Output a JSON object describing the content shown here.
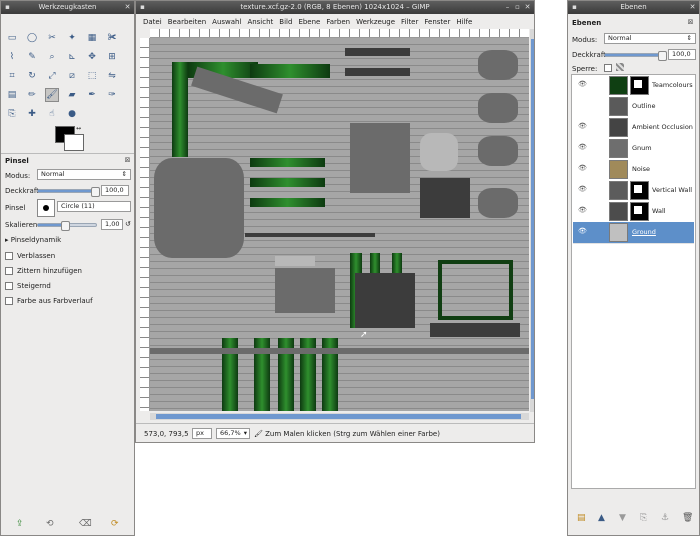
{
  "toolbox": {
    "title": "Werkzeugkasten",
    "tools": [
      {
        "name": "rect-select-icon",
        "glyph": "▭"
      },
      {
        "name": "ellipse-select-icon",
        "glyph": "◯"
      },
      {
        "name": "free-select-icon",
        "glyph": "✂"
      },
      {
        "name": "fuzzy-select-icon",
        "glyph": "✦"
      },
      {
        "name": "color-select-icon",
        "glyph": "▦"
      },
      {
        "name": "scissors-icon",
        "glyph": "✀"
      },
      {
        "name": "paths-icon",
        "glyph": "⌇"
      },
      {
        "name": "color-picker-icon",
        "glyph": "✎"
      },
      {
        "name": "zoom-icon",
        "glyph": "⌕"
      },
      {
        "name": "measure-icon",
        "glyph": "⊾"
      },
      {
        "name": "move-icon",
        "glyph": "✥"
      },
      {
        "name": "align-icon",
        "glyph": "⊞"
      },
      {
        "name": "crop-icon",
        "glyph": "⌗"
      },
      {
        "name": "rotate-icon",
        "glyph": "↻"
      },
      {
        "name": "scale-icon",
        "glyph": "⤢"
      },
      {
        "name": "shear-icon",
        "glyph": "⧄"
      },
      {
        "name": "perspective-icon",
        "glyph": "⬚"
      },
      {
        "name": "flip-icon",
        "glyph": "⇋"
      },
      {
        "name": "gradient-icon",
        "glyph": "▤"
      },
      {
        "name": "pencil-icon",
        "glyph": "✏"
      },
      {
        "name": "paintbrush-icon",
        "glyph": "🖌"
      },
      {
        "name": "eraser-icon",
        "glyph": "▰"
      },
      {
        "name": "airbrush-icon",
        "glyph": "✒"
      },
      {
        "name": "ink-icon",
        "glyph": "✑"
      },
      {
        "name": "clone-icon",
        "glyph": "⎘"
      },
      {
        "name": "heal-icon",
        "glyph": "✚"
      },
      {
        "name": "smudge-icon",
        "glyph": "☝"
      },
      {
        "name": "dodge-burn-icon",
        "glyph": "●"
      }
    ],
    "active_tool_index": 20,
    "brush_panel": {
      "title": "Pinsel",
      "mode_label": "Modus:",
      "mode_value": "Normal",
      "opacity_label": "Deckkraft:",
      "opacity_value": "100,0",
      "opacity_fraction": 1.0,
      "brush_label": "Pinsel",
      "brush_value": "Circle (11)",
      "scale_label": "Skalieren:",
      "scale_value": "1,00",
      "scale_fraction": 0.5,
      "dynamics_label": "Pinseldynamik",
      "options": [
        "Verblassen",
        "Zittern hinzufügen",
        "Steigernd",
        "Farbe aus Farbverlauf"
      ]
    }
  },
  "image_window": {
    "title": "texture.xcf.gz-2.0 (RGB, 8 Ebenen) 1024x1024 – GIMP",
    "menu": [
      "Datei",
      "Bearbeiten",
      "Auswahl",
      "Ansicht",
      "Bild",
      "Ebene",
      "Farben",
      "Werkzeuge",
      "Filter",
      "Fenster",
      "Hilfe"
    ],
    "coords": "573,0, 793,5",
    "unit": "px",
    "zoom": "66,7%",
    "status": "Zum Malen klicken (Strg zum Wählen einer Farbe)"
  },
  "layers": {
    "title": "Ebenen",
    "tab_label": "Ebenen",
    "mode_label": "Modus:",
    "mode_value": "Normal",
    "opacity_label": "Deckkraft:",
    "opacity_value": "100,0",
    "opacity_fraction": 1.0,
    "lock_label": "Sperre:",
    "items": [
      {
        "name": "Teamcolours",
        "visible": true,
        "has_mask": true,
        "thumb": "#0f3f12",
        "selected": false
      },
      {
        "name": "Outline",
        "visible": false,
        "has_mask": false,
        "thumb": "#5a5a5a",
        "selected": false
      },
      {
        "name": "Ambient Occlusion",
        "visible": true,
        "has_mask": false,
        "thumb": "#444444",
        "selected": false
      },
      {
        "name": "Gnum",
        "visible": true,
        "has_mask": false,
        "thumb": "#6e6e6e",
        "selected": false
      },
      {
        "name": "Noise",
        "visible": true,
        "has_mask": false,
        "thumb": "#a08a5a",
        "selected": false
      },
      {
        "name": "Vertical Wall",
        "visible": true,
        "has_mask": true,
        "thumb": "#5c5c5c",
        "selected": false
      },
      {
        "name": "Wall",
        "visible": true,
        "has_mask": true,
        "thumb": "#4c4c4c",
        "selected": false
      },
      {
        "name": "Ground",
        "visible": true,
        "has_mask": false,
        "thumb": "#c0c0c0",
        "selected": true
      }
    ],
    "bottom_icons": [
      "new-layer-icon",
      "raise-layer-icon",
      "lower-layer-icon",
      "duplicate-layer-icon",
      "anchor-layer-icon",
      "delete-layer-icon"
    ]
  },
  "colors": {
    "accent": "#5d8fc9",
    "titlebar": "#474747",
    "green": "#2f8f2e"
  }
}
